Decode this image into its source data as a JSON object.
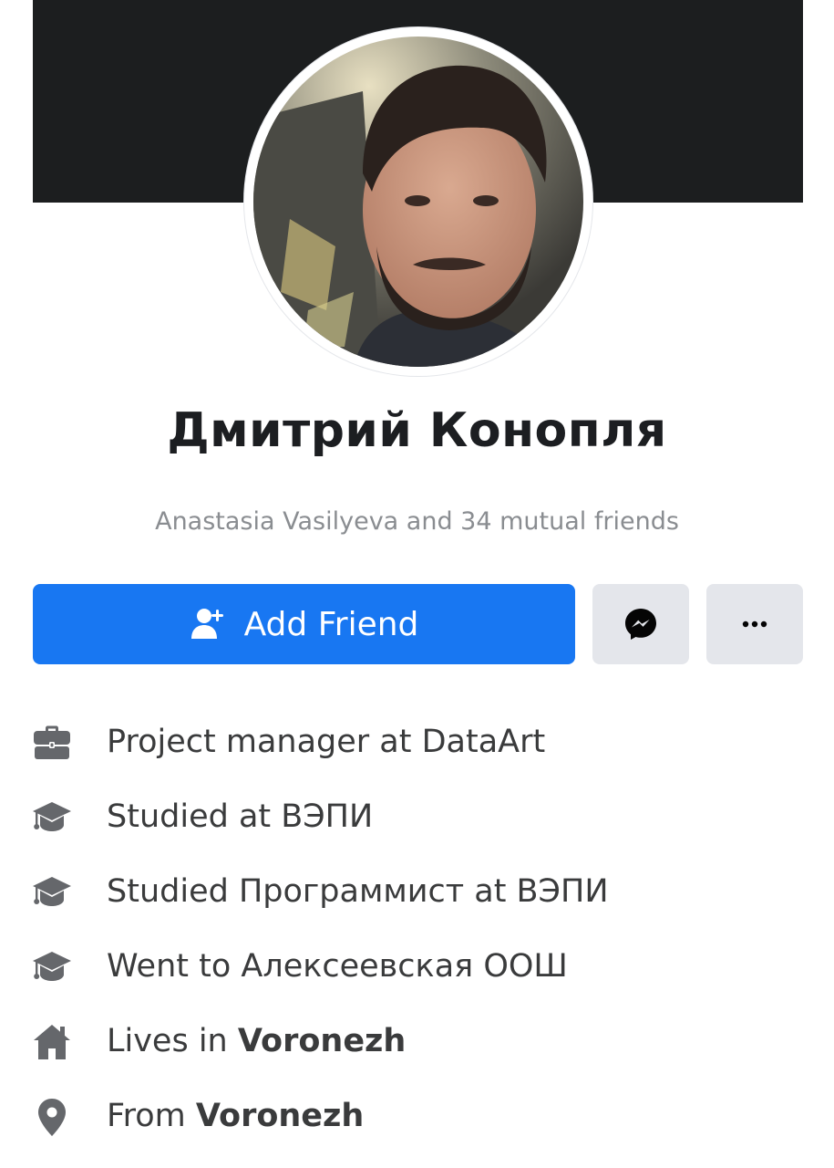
{
  "profile": {
    "name": "Дмитрий Конопля",
    "mutual_friends": "Anastasia Vasilyeva and 34 mutual friends"
  },
  "actions": {
    "add_friend_label": "Add Friend",
    "add_friend_icon": "add-friend-icon",
    "message_icon": "messenger-icon",
    "more_icon": "more-icon"
  },
  "details": {
    "work": "Project manager at DataArt",
    "study_1": "Studied at ВЭПИ",
    "study_2": "Studied Программист at ВЭПИ",
    "school": "Went to Алексеевская ООШ",
    "lives_prefix": "Lives in ",
    "lives_city": "Voronezh",
    "from_prefix": "From ",
    "from_city": "Voronezh"
  },
  "colors": {
    "accent": "#1877f2",
    "cover": "#1c1e1f",
    "icon": "#65676b",
    "secondary_button": "#e4e6eb"
  }
}
